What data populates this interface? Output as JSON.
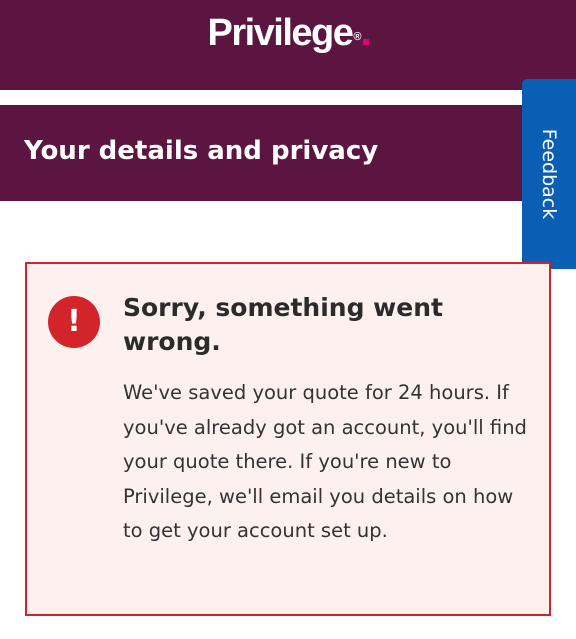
{
  "header": {
    "logo_text": "Privilege",
    "logo_registered_mark": "®"
  },
  "page": {
    "title": "Your details and privacy"
  },
  "feedback": {
    "label": "Feedback"
  },
  "error": {
    "icon_symbol": "!",
    "heading": "Sorry, something went wrong.",
    "message": "We've saved your quote for 24 hours. If you've already got an account, you'll find your quote there. If you're new to Privilege, we'll email you details on how to get your account set up."
  },
  "colors": {
    "brand_plum": "#5b1540",
    "logo_dot": "#e4007c",
    "feedback_blue": "#0a5fb4",
    "error_red": "#d4242b",
    "error_bg": "#fdf1ef"
  }
}
